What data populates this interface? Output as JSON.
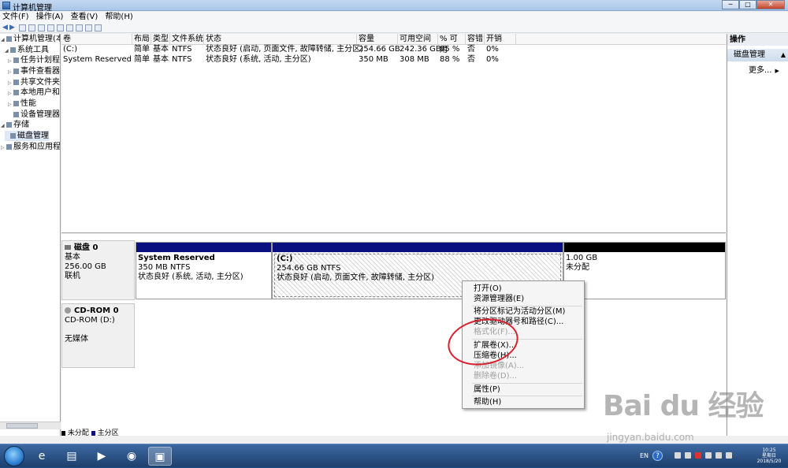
{
  "window": {
    "title": "计算机管理",
    "controls": {
      "minimize": "─",
      "maximize": "□",
      "close": "✕"
    }
  },
  "menu": [
    "文件(F)",
    "操作(A)",
    "查看(V)",
    "帮助(H)"
  ],
  "tree": {
    "items": [
      {
        "label": "计算机管理(本地",
        "level": 0
      },
      {
        "label": "系统工具",
        "level": 1
      },
      {
        "label": "任务计划程",
        "level": 2
      },
      {
        "label": "事件查看器",
        "level": 2
      },
      {
        "label": "共享文件夹",
        "level": 2
      },
      {
        "label": "本地用户和",
        "level": 2
      },
      {
        "label": "性能",
        "level": 2
      },
      {
        "label": "设备管理器",
        "level": 2
      },
      {
        "label": "存储",
        "level": 1
      },
      {
        "label": "磁盘管理",
        "level": 2
      },
      {
        "label": "服务和应用程",
        "level": 1
      }
    ]
  },
  "volumes": {
    "columns": [
      "卷",
      "布局",
      "类型",
      "文件系统",
      "状态",
      "容量",
      "可用空间",
      "% 可用",
      "容错",
      "开销"
    ],
    "rows": [
      [
        "(C:)",
        "简单",
        "基本",
        "NTFS",
        "状态良好 (启动, 页面文件, 故障转储, 主分区)",
        "254.66 GB",
        "242.36 GB",
        "95 %",
        "否",
        "0%"
      ],
      [
        "System Reserved",
        "简单",
        "基本",
        "NTFS",
        "状态良好 (系统, 活动, 主分区)",
        "350 MB",
        "308 MB",
        "88 %",
        "否",
        "0%"
      ]
    ]
  },
  "disk0": {
    "name": "磁盘 0",
    "type": "基本",
    "size": "256.00 GB",
    "status": "联机",
    "partitions": [
      {
        "name": "System Reserved",
        "size": "350 MB NTFS",
        "status": "状态良好 (系统, 活动, 主分区)"
      },
      {
        "name": "(C:)",
        "size": "254.66 GB NTFS",
        "status": "状态良好 (启动, 页面文件, 故障转储, 主分区)"
      },
      {
        "name": "",
        "size": "1.00 GB",
        "status": "未分配"
      }
    ]
  },
  "cdrom": {
    "name": "CD-ROM 0",
    "type": "CD-ROM (D:)",
    "status": "无媒体"
  },
  "legend": {
    "unallocated": "未分配",
    "primary": "主分区"
  },
  "actions": {
    "header": "操作",
    "section": "磁盘管理",
    "more": "更多..."
  },
  "context_menu": [
    {
      "label": "打开(O)",
      "enabled": true
    },
    {
      "label": "资源管理器(E)",
      "enabled": true
    },
    {
      "label": "将分区标记为活动分区(M)",
      "enabled": true
    },
    {
      "label": "更改驱动器号和路径(C)...",
      "enabled": true
    },
    {
      "label": "格式化(F)...",
      "enabled": false
    },
    {
      "label": "扩展卷(X)...",
      "enabled": true
    },
    {
      "label": "压缩卷(H)...",
      "enabled": true
    },
    {
      "label": "添加镜像(A)...",
      "enabled": false
    },
    {
      "label": "删除卷(D)...",
      "enabled": false
    },
    {
      "label": "属性(P)",
      "enabled": true
    },
    {
      "label": "帮助(H)",
      "enabled": true
    }
  ],
  "taskbar": {
    "lang": "EN",
    "help": "?",
    "clock_time": "10:25",
    "clock_day": "星期日",
    "clock_date": "2018/5/20"
  },
  "watermark": {
    "brand": "Bai du 经验",
    "url": "jingyan.baidu.com"
  },
  "colors": {
    "primary_bar": "#0b1080",
    "unallocated_bar": "#000000",
    "highlight_ring": "#d9202c",
    "taskbar": "#1d3f6b"
  }
}
